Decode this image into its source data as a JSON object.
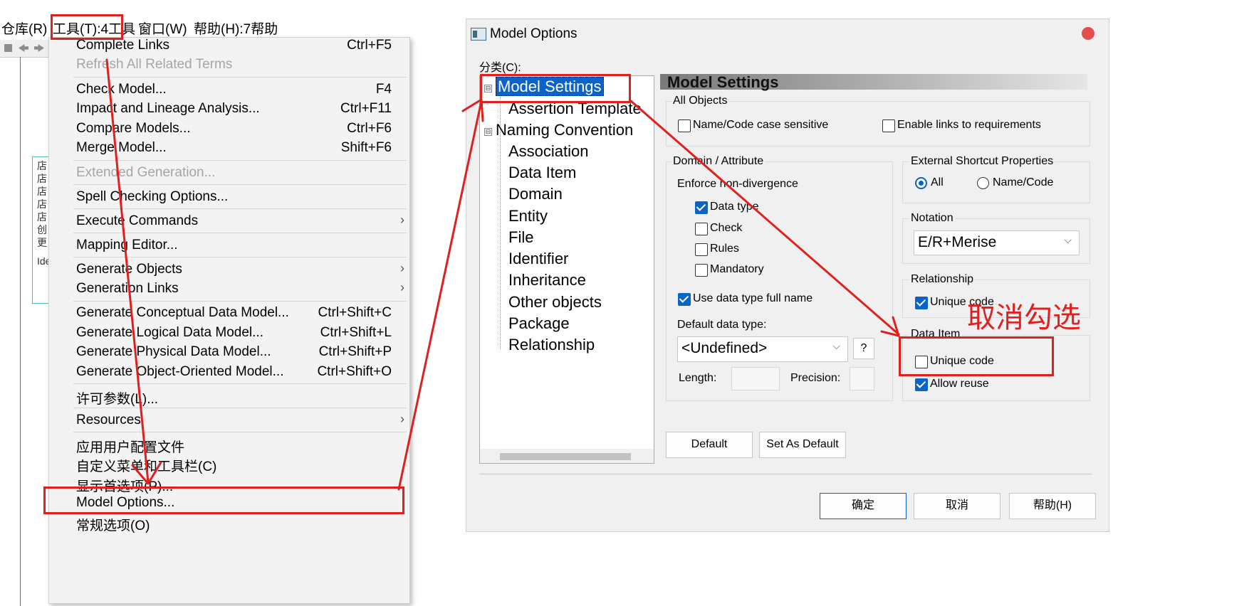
{
  "left_app": {
    "menubar": [
      {
        "label": "仓库(R)"
      },
      {
        "label": "工具(T):4工具"
      },
      {
        "label": "窗口(W)"
      },
      {
        "label": "帮助(H):7帮助"
      }
    ],
    "canvas_glyphs": [
      "店",
      "店",
      "店",
      "店",
      "店",
      "创",
      "更",
      "Ide"
    ],
    "tools_menu": {
      "items": [
        {
          "label": "Complete Links",
          "shortcut": "Ctrl+F5",
          "disabled": false
        },
        {
          "label": "Refresh All Related Terms",
          "shortcut": "",
          "disabled": true
        },
        {
          "label": "Check Model...",
          "shortcut": "F4",
          "disabled": false
        },
        {
          "label": "Impact and Lineage Analysis...",
          "shortcut": "Ctrl+F11",
          "disabled": false
        },
        {
          "label": "Compare Models...",
          "shortcut": "Ctrl+F6",
          "disabled": false
        },
        {
          "label": "Merge Model...",
          "shortcut": "Shift+F6",
          "disabled": false
        },
        {
          "label": "Extended Generation...",
          "shortcut": "",
          "disabled": true
        },
        {
          "label": "Spell Checking Options...",
          "shortcut": "",
          "disabled": false
        },
        {
          "label": "Execute Commands",
          "shortcut": "",
          "submenu": true,
          "disabled": false
        },
        {
          "label": "Mapping Editor...",
          "shortcut": "",
          "disabled": false
        },
        {
          "label": "Generate Objects",
          "shortcut": "",
          "submenu": true,
          "disabled": false
        },
        {
          "label": "Generation Links",
          "shortcut": "",
          "submenu": true,
          "disabled": false
        },
        {
          "label": "Generate Conceptual Data Model...",
          "shortcut": "Ctrl+Shift+C",
          "disabled": false
        },
        {
          "label": "Generate Logical Data Model...",
          "shortcut": "Ctrl+Shift+L",
          "disabled": false
        },
        {
          "label": "Generate Physical Data Model...",
          "shortcut": "Ctrl+Shift+P",
          "disabled": false
        },
        {
          "label": "Generate Object-Oriented Model...",
          "shortcut": "Ctrl+Shift+O",
          "disabled": false
        },
        {
          "label": "许可参数(L)...",
          "shortcut": "",
          "disabled": false
        },
        {
          "label": "Resources",
          "shortcut": "",
          "submenu": true,
          "disabled": false
        },
        {
          "label": "应用用户配置文件",
          "shortcut": "",
          "disabled": false
        },
        {
          "label": "自定义菜单和工具栏(C)",
          "shortcut": "",
          "disabled": false
        },
        {
          "label": "显示首选项(P)...",
          "shortcut": "",
          "disabled": false
        },
        {
          "label": "Model Options...",
          "shortcut": "",
          "disabled": false
        },
        {
          "label": "常规选项(O)",
          "shortcut": "",
          "disabled": false
        }
      ]
    }
  },
  "dialog": {
    "title": "Model Options",
    "category_label": "分类(C):",
    "tree": [
      {
        "label": "Model Settings",
        "level": 0,
        "selected": true,
        "expander": "⊟"
      },
      {
        "label": "Assertion Template",
        "level": 1
      },
      {
        "label": "Naming Convention",
        "level": 0,
        "expander": "⊟"
      },
      {
        "label": "Association",
        "level": 1
      },
      {
        "label": "Data Item",
        "level": 1
      },
      {
        "label": "Domain",
        "level": 1
      },
      {
        "label": "Entity",
        "level": 1
      },
      {
        "label": "File",
        "level": 1
      },
      {
        "label": "Identifier",
        "level": 1
      },
      {
        "label": "Inheritance",
        "level": 1
      },
      {
        "label": "Other objects",
        "level": 1
      },
      {
        "label": "Package",
        "level": 1
      },
      {
        "label": "Relationship",
        "level": 1
      }
    ],
    "section_title": "Model Settings",
    "all_objects": {
      "title": "All Objects",
      "name_code_case": {
        "label": "Name/Code case sensitive",
        "checked": false
      },
      "enable_links": {
        "label": "Enable links to requirements",
        "checked": false
      }
    },
    "domain_attribute": {
      "title": "Domain / Attribute",
      "enforce_label": "Enforce non-divergence",
      "data_type": {
        "label": "Data type",
        "checked": true
      },
      "check": {
        "label": "Check",
        "checked": false
      },
      "rules": {
        "label": "Rules",
        "checked": false
      },
      "mandatory": {
        "label": "Mandatory",
        "checked": false
      },
      "use_full_name": {
        "label": "Use data type full name",
        "checked": true
      },
      "default_type_label": "Default data type:",
      "default_type_value": "<Undefined>",
      "help_button": "?",
      "length_label": "Length:",
      "precision_label": "Precision:"
    },
    "external_shortcut": {
      "title": "External Shortcut Properties",
      "all": {
        "label": "All",
        "selected": true
      },
      "name_code": {
        "label": "Name/Code",
        "selected": false
      }
    },
    "notation": {
      "title": "Notation",
      "value": "E/R+Merise"
    },
    "relationship": {
      "title": "Relationship",
      "unique_code": {
        "label": "Unique code",
        "checked": true
      }
    },
    "data_item": {
      "title": "Data Item",
      "unique_code": {
        "label": "Unique code",
        "checked": false
      },
      "allow_reuse": {
        "label": "Allow reuse",
        "checked": true
      }
    },
    "buttons": {
      "default": "Default",
      "set_as_default": "Set As Default",
      "ok": "确定",
      "cancel": "取消",
      "help": "帮助(H)"
    }
  },
  "annotation": {
    "text": "取消勾选",
    "color": "#e0201e"
  },
  "colors": {
    "selection": "#0b63c7",
    "checkbox_accent": "#0a64c8",
    "annotation_red": "#e0201e"
  }
}
